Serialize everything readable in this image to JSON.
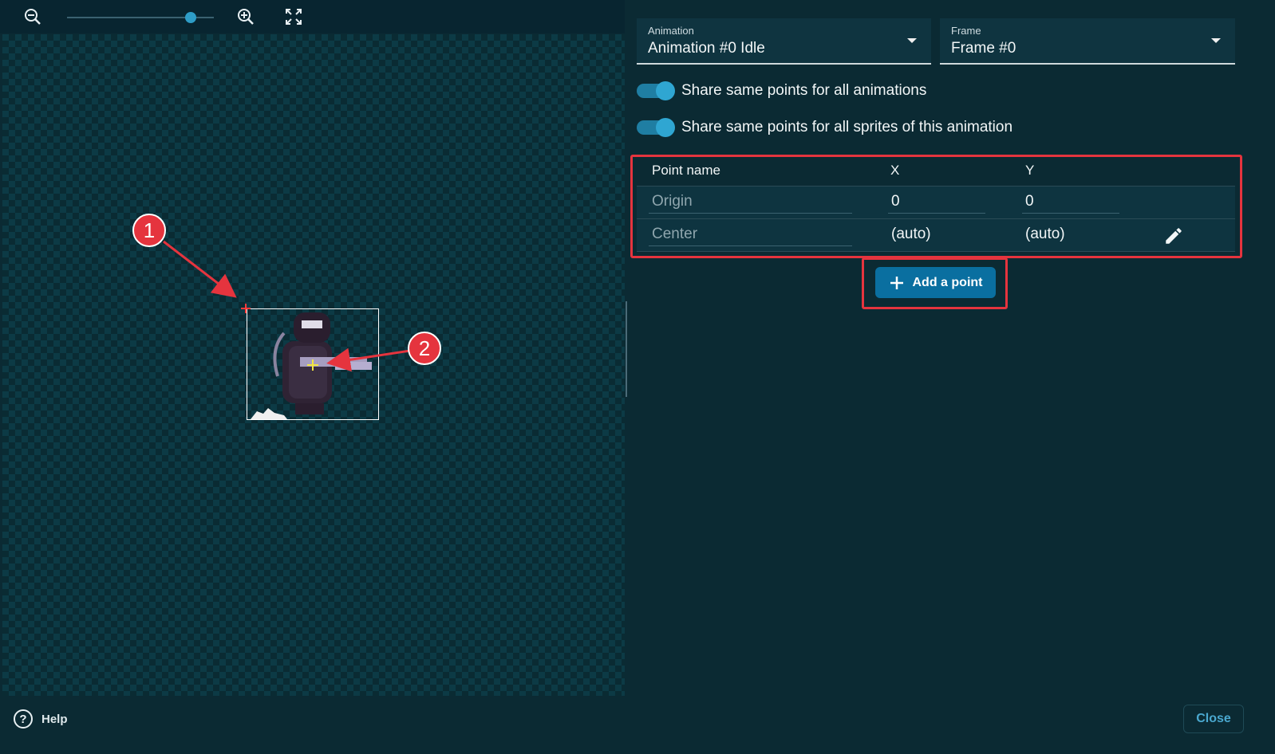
{
  "toolbar": {
    "zoom_level": 0.84,
    "icons": [
      "zoom-out-icon",
      "zoom-in-icon",
      "fit-screen-icon"
    ]
  },
  "selects": {
    "animation": {
      "label": "Animation",
      "value": "Animation #0 Idle"
    },
    "frame": {
      "label": "Frame",
      "value": "Frame #0"
    }
  },
  "toggles": [
    {
      "label": "Share same points for all animations",
      "checked": true
    },
    {
      "label": "Share same points for all sprites of this animation",
      "checked": true
    }
  ],
  "points_table": {
    "headers": {
      "name": "Point name",
      "x": "X",
      "y": "Y"
    },
    "rows": [
      {
        "name": "Origin",
        "x": "0",
        "y": "0"
      },
      {
        "name": "Center",
        "x": "(auto)",
        "y": "(auto)"
      }
    ]
  },
  "add_point_label": "Add a point",
  "annotations": {
    "marker_1": "1",
    "marker_2": "2"
  },
  "footer": {
    "help_label": "Help",
    "close_label": "Close"
  },
  "colors": {
    "accent": "#2e9dc7",
    "button": "#0a6fa0",
    "highlight": "#e5343e",
    "background": "#0b2a33"
  }
}
